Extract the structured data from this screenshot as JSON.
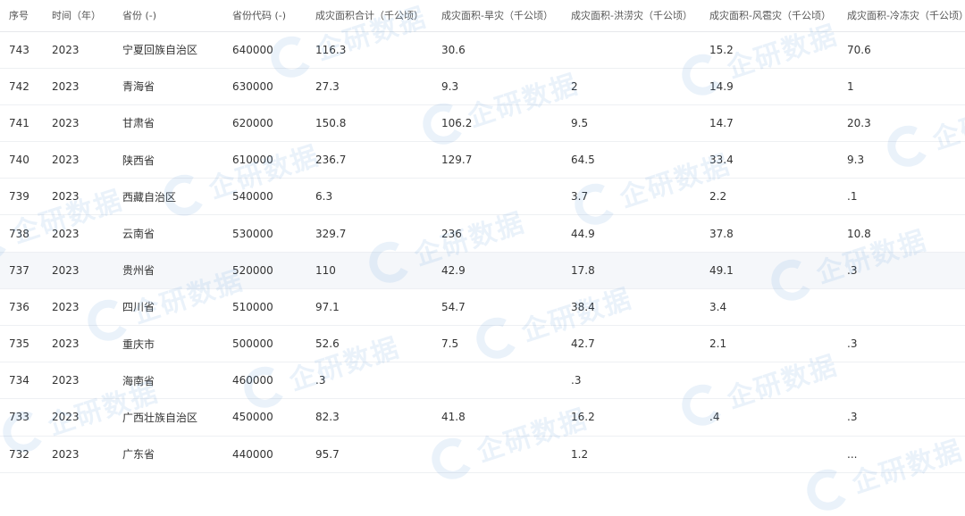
{
  "table": {
    "headers": [
      "序号",
      "时间（年）",
      "省份 (-)",
      "省份代码 (-)",
      "成灾面积合计（千公顷）",
      "成灾面积-旱灾（千公顷）",
      "成灾面积-洪涝灾（千公顷）",
      "成灾面积-风雹灾（千公顷）",
      "成灾面积-冷冻灾（千公顷）"
    ],
    "rows": [
      [
        "743",
        "2023",
        "宁夏回族自治区",
        "640000",
        "116.3",
        "30.6",
        "",
        "15.2",
        "70.6"
      ],
      [
        "742",
        "2023",
        "青海省",
        "630000",
        "27.3",
        "9.3",
        "2",
        "14.9",
        "1"
      ],
      [
        "741",
        "2023",
        "甘肃省",
        "620000",
        "150.8",
        "106.2",
        "9.5",
        "14.7",
        "20.3"
      ],
      [
        "740",
        "2023",
        "陕西省",
        "610000",
        "236.7",
        "129.7",
        "64.5",
        "33.4",
        "9.3"
      ],
      [
        "739",
        "2023",
        "西藏自治区",
        "540000",
        "6.3",
        "",
        "3.7",
        "2.2",
        ".1"
      ],
      [
        "738",
        "2023",
        "云南省",
        "530000",
        "329.7",
        "236",
        "44.9",
        "37.8",
        "10.8"
      ],
      [
        "737",
        "2023",
        "贵州省",
        "520000",
        "110",
        "42.9",
        "17.8",
        "49.1",
        ".3"
      ],
      [
        "736",
        "2023",
        "四川省",
        "510000",
        "97.1",
        "54.7",
        "38.4",
        "3.4",
        ""
      ],
      [
        "735",
        "2023",
        "重庆市",
        "500000",
        "52.6",
        "7.5",
        "42.7",
        "2.1",
        ".3"
      ],
      [
        "734",
        "2023",
        "海南省",
        "460000",
        ".3",
        "",
        ".3",
        "",
        ""
      ],
      [
        "733",
        "2023",
        "广西壮族自治区",
        "450000",
        "82.3",
        "41.8",
        "16.2",
        ".4",
        ".3"
      ],
      [
        "732",
        "2023",
        "广东省",
        "440000",
        "95.7",
        "",
        "1.2",
        "",
        "..."
      ]
    ],
    "highlighted_row_index": 6
  },
  "watermark": {
    "text": "企研数据",
    "color": "#3a86d6"
  }
}
